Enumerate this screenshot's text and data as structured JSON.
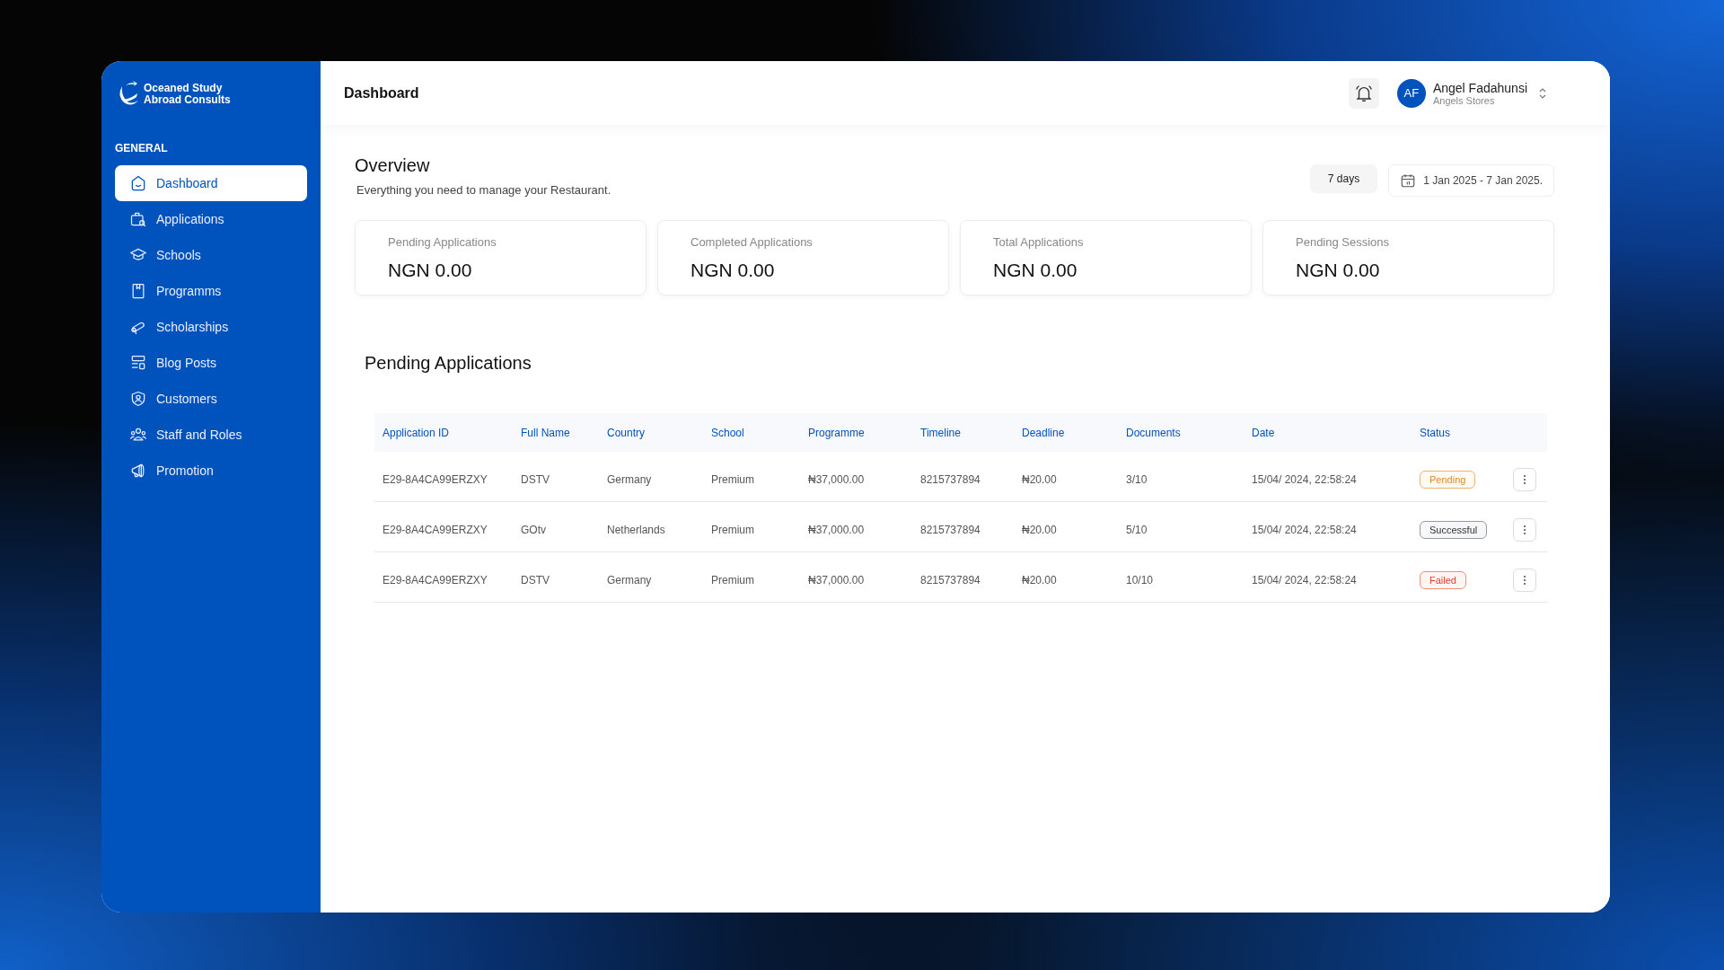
{
  "brand": {
    "name": "Oceaned Study Abroad Consults"
  },
  "sidebar": {
    "section": "GENERAL",
    "items": [
      {
        "label": "Dashboard",
        "selected": true
      },
      {
        "label": "Applications",
        "selected": false
      },
      {
        "label": "Schools",
        "selected": false
      },
      {
        "label": "Programms",
        "selected": false
      },
      {
        "label": "Scholarships",
        "selected": false
      },
      {
        "label": "Blog Posts",
        "selected": false
      },
      {
        "label": "Customers",
        "selected": false
      },
      {
        "label": "Staff and Roles",
        "selected": false
      },
      {
        "label": "Promotion",
        "selected": false
      }
    ]
  },
  "header": {
    "title": "Dashboard",
    "user": {
      "initials": "AF",
      "name": "Angel Fadahunsi",
      "store": "Angels Stores"
    }
  },
  "overview": {
    "title": "Overview",
    "subtitle": "Everything you need to manage your Restaurant.",
    "period": "7 days",
    "date_range": "1 Jan 2025 - 7 Jan 2025."
  },
  "stats": [
    {
      "label": "Pending Applications",
      "value": "NGN 0.00"
    },
    {
      "label": "Completed Applications",
      "value": "NGN 0.00"
    },
    {
      "label": "Total Applications",
      "value": "NGN 0.00"
    },
    {
      "label": "Pending Sessions",
      "value": "NGN 0.00"
    }
  ],
  "table": {
    "title": "Pending Applications",
    "columns": [
      "Application ID",
      "Full Name",
      "Country",
      "School",
      "Programme",
      "Timeline",
      "Deadline",
      "Documents",
      "Date",
      "Status"
    ],
    "rows": [
      {
        "cells": [
          "E29-8A4CA99ERZXY",
          "DSTV",
          "Germany",
          "Premium",
          "₦37,000.00",
          "8215737894",
          "₦20.00",
          "3/10",
          "15/04/ 2024, 22:58:24"
        ],
        "status": "Pending",
        "kind": "pending"
      },
      {
        "cells": [
          "E29-8A4CA99ERZXY",
          "GOtv",
          "Netherlands",
          "Premium",
          "₦37,000.00",
          "8215737894",
          "₦20.00",
          "5/10",
          "15/04/ 2024, 22:58:24"
        ],
        "status": "Successful",
        "kind": "successful"
      },
      {
        "cells": [
          "E29-8A4CA99ERZXY",
          "DSTV",
          "Germany",
          "Premium",
          "₦37,000.00",
          "8215737894",
          "₦20.00",
          "10/10",
          "15/04/ 2024, 22:58:24"
        ],
        "status": "Failed",
        "kind": "failed"
      }
    ]
  }
}
